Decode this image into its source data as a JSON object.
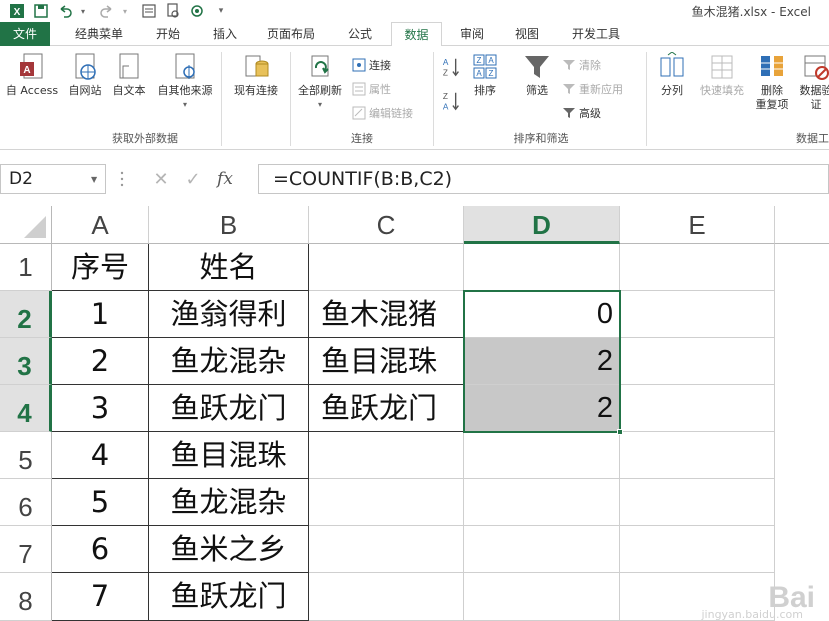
{
  "window": {
    "title": "鱼木混猪.xlsx - Excel"
  },
  "tabs": [
    {
      "label": "文件",
      "kind": "file"
    },
    {
      "label": "经典菜单"
    },
    {
      "label": "开始"
    },
    {
      "label": "插入"
    },
    {
      "label": "页面布局"
    },
    {
      "label": "公式"
    },
    {
      "label": "数据",
      "active": true
    },
    {
      "label": "审阅"
    },
    {
      "label": "视图"
    },
    {
      "label": "开发工具"
    }
  ],
  "ribbon": {
    "get_external": {
      "buttons": [
        "自 Access",
        "自网站",
        "自文本",
        "自其他来源",
        "现有连接"
      ],
      "label": "获取外部数据"
    },
    "connections": {
      "refresh_all": "全部刷新",
      "items": [
        "连接",
        "属性",
        "编辑链接"
      ],
      "label": "连接"
    },
    "sort_filter": {
      "sort": "排序",
      "filter": "筛选",
      "items": [
        "清除",
        "重新应用",
        "高级"
      ],
      "label": "排序和筛选"
    },
    "data_tools": {
      "buttons": [
        "分列",
        "快速填充",
        "删除",
        "重复项",
        "数据验",
        "证"
      ],
      "label": "数据工"
    }
  },
  "formula_bar": {
    "name_box": "D2",
    "formula": "=COUNTIF(B:B,C2)"
  },
  "grid": {
    "columns": [
      "A",
      "B",
      "C",
      "D",
      "E"
    ],
    "selected_column": "D",
    "rows": [
      "1",
      "2",
      "3",
      "4",
      "5",
      "6",
      "7",
      "8"
    ],
    "selected_rows": [
      "2",
      "3",
      "4"
    ],
    "cells": {
      "A1": "序号",
      "B1": "姓名",
      "A2": "1",
      "B2": "渔翁得利",
      "C2": "鱼木混猪",
      "D2": "0",
      "A3": "2",
      "B3": "鱼龙混杂",
      "C3": "鱼目混珠",
      "D3": "2",
      "A4": "3",
      "B4": "鱼跃龙门",
      "C4": "鱼跃龙门",
      "D4": "2",
      "A5": "4",
      "B5": "鱼目混珠",
      "A6": "5",
      "B6": "鱼龙混杂",
      "A7": "6",
      "B7": "鱼米之乡",
      "A8": "7",
      "B8": "鱼跃龙门"
    }
  },
  "colors": {
    "accent": "#217346",
    "selection_fill": "#c8c8c8"
  },
  "watermark": {
    "text": "Bai",
    "sub": "jingyan.baidu.com"
  }
}
